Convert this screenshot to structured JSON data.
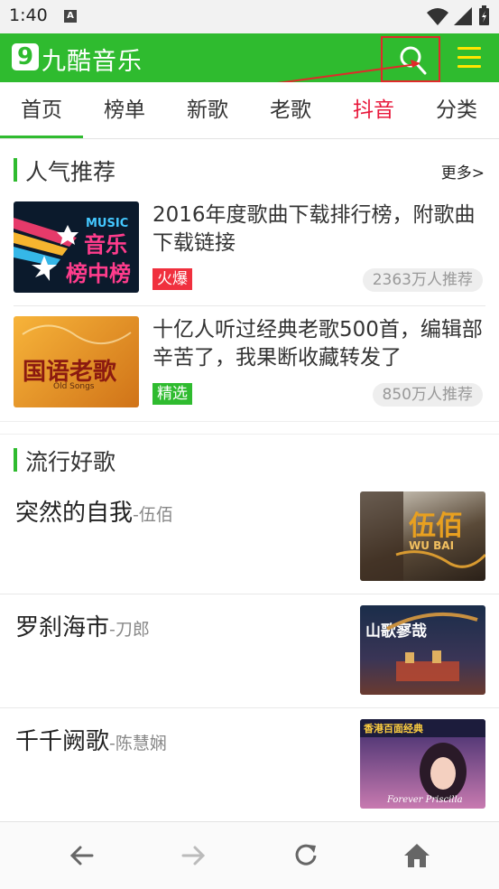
{
  "statusbar": {
    "time": "1:40",
    "notif_letter": "A"
  },
  "header": {
    "logo_digit": "9",
    "logo_text": "九酷音乐",
    "search_label": "search",
    "menu_label": "menu"
  },
  "tabs": [
    {
      "label": "首页"
    },
    {
      "label": "榜单"
    },
    {
      "label": "新歌"
    },
    {
      "label": "老歌"
    },
    {
      "label": "抖音"
    },
    {
      "label": "分类"
    }
  ],
  "popular": {
    "title": "人气推荐",
    "more": "更多>",
    "items": [
      {
        "title": "2016年度歌曲下载排行榜，附歌曲下载链接",
        "tag": "火爆",
        "tag_color": "#f0303e",
        "count": "2363万人推荐",
        "thumb_text": [
          "MUSIC",
          "音乐",
          "榜中榜"
        ]
      },
      {
        "title": "十亿人听过经典老歌500首，编辑部辛苦了，我果断收藏转发了",
        "tag": "精选",
        "tag_color": "#2fbb2f",
        "count": "850万人推荐",
        "thumb_text": [
          "国语老歌",
          "Old Songs"
        ]
      }
    ]
  },
  "trending": {
    "title": "流行好歌",
    "songs": [
      {
        "title": "突然的自我",
        "artist": "-伍佰",
        "cover_text": [
          "伍佰",
          "WU BAI"
        ]
      },
      {
        "title": "罗刹海市",
        "artist": "-刀郎",
        "cover_text": [
          "山歌寥哉"
        ]
      },
      {
        "title": "千千阙歌",
        "artist": "-陈慧娴",
        "cover_text": [
          "香港百面经典",
          "Forever Priscilla"
        ]
      }
    ]
  },
  "bottom_nav": [
    "back",
    "forward",
    "refresh",
    "home"
  ],
  "colors": {
    "brand_green": "#2fbb2f",
    "hot_red": "#e8193c",
    "menu_yellow": "#ffe500",
    "highlight_box": "#e02a2a"
  }
}
